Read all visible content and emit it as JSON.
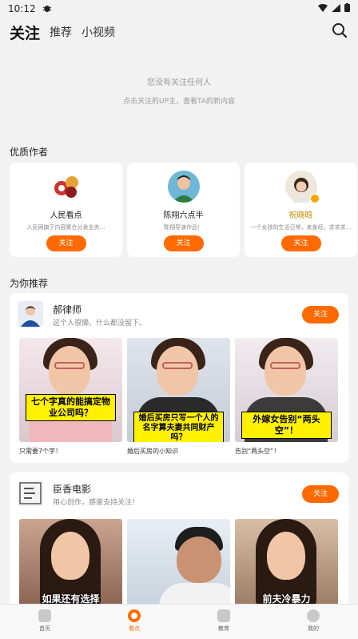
{
  "status_bar": {
    "time": "10:12",
    "app_icon": "bug-icon",
    "icons": [
      "wifi-icon",
      "signal-icon",
      "battery-icon"
    ]
  },
  "top_nav": {
    "tabs": [
      {
        "label": "关注"
      },
      {
        "label": "推荐"
      },
      {
        "label": "小视频"
      }
    ],
    "search_icon": "search-icon"
  },
  "empty_state": {
    "title": "您没有关注任何人",
    "subtitle": "点击关注的UP主，查看TA的新内容"
  },
  "quality_authors": {
    "section_title": "优质作者",
    "authors": [
      {
        "name": "人民看点",
        "desc": "人民网旗下内容聚合分发业务…",
        "follow_label": "关注"
      },
      {
        "name": "陈翔六点半",
        "desc": "陈翔导演作品！",
        "follow_label": "关注"
      },
      {
        "name": "祝晓晗",
        "desc": "一个女孩的生活日常，来身经，求求求…",
        "follow_label": "关注"
      }
    ]
  },
  "recommend": {
    "section_title": "为你推荐",
    "cards": [
      {
        "name": "郝律师",
        "desc": "这个人很懒，什么都没留下。",
        "follow_label": "关注",
        "videos": [
          {
            "caption": "七个字真的能搞定物业公司吗？",
            "title": "只需要7个字！"
          },
          {
            "caption": "婚后买房只写一个人的名字算夫妻共同财产吗？",
            "title": "婚后买房的小知识"
          },
          {
            "caption": "外嫁女告别“两头空”！",
            "title": "告别“两头空”！"
          }
        ]
      },
      {
        "name": "臣香电影",
        "desc": "用心创作，感谢支持关注！",
        "follow_label": "关注",
        "videos": [
          {
            "caption": "如果还有选择"
          },
          {
            "caption": ""
          },
          {
            "caption": "前夫冷暴力"
          }
        ]
      }
    ]
  },
  "bottom_nav": {
    "items": [
      {
        "label": "首页",
        "icon": "home-icon"
      },
      {
        "label": "看点",
        "icon": "highlights-icon"
      },
      {
        "label": "教育",
        "icon": "education-icon"
      },
      {
        "label": "我的",
        "icon": "profile-icon"
      }
    ],
    "active_index": 1
  },
  "colors": {
    "accent": "#ff6a00",
    "gold_name": "#c68a00",
    "caption_yellow": "#fff100"
  }
}
